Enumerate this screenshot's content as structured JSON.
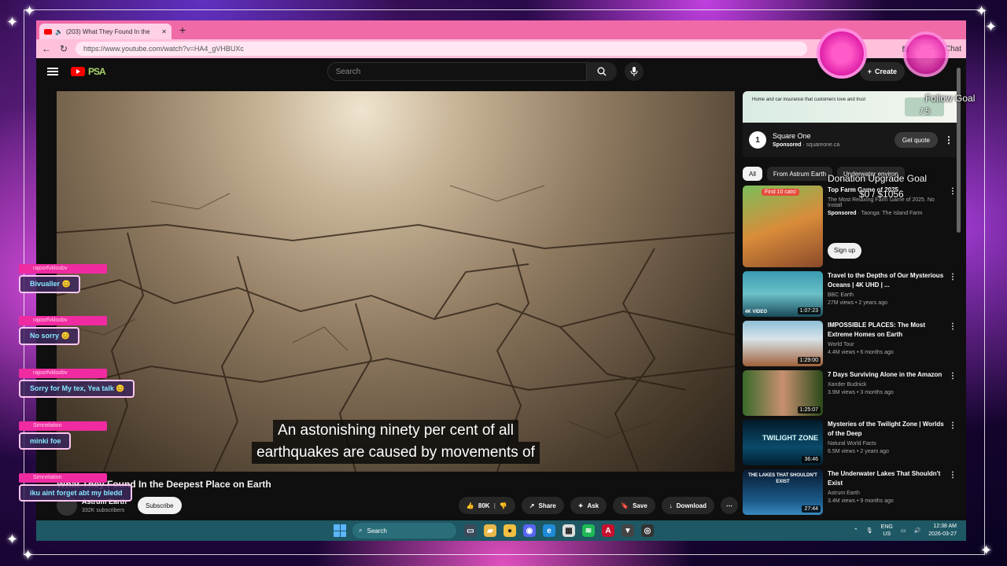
{
  "browser": {
    "tab_title": "(203) What They Found In the",
    "url": "https://www.youtube.com/watch?v=HA4_gVHBUXc",
    "chat_label": "Chat"
  },
  "youtube": {
    "search_placeholder": "Search",
    "create_label": "Create",
    "doodle": "PSA"
  },
  "video": {
    "title": "What They Found In the Deepest Place on Earth",
    "caption_line1": "An astonishing ninety per cent of all",
    "caption_line2": "earthquakes are caused by movements of",
    "channel_name": "Astrum Earth",
    "subscribers": "332K subscribers",
    "subscribe_label": "Subscribe",
    "likes": "80K",
    "share_label": "Share",
    "ask_label": "Ask",
    "save_label": "Save",
    "download_label": "Download"
  },
  "ad": {
    "banner_text": "Home and car insurance that customers love and trust",
    "advertiser": "Square One",
    "sponsored": "Sponsored",
    "domain": "squareone.ca",
    "cta": "Get quote"
  },
  "chips": [
    "All",
    "From Astrum Earth",
    "Underwater environ"
  ],
  "recommendations": [
    {
      "title": "Top Farm Game of 2025",
      "line2": "The Most Relaxing Farm Game of 2025. No Install",
      "sponsor": "Sponsored",
      "advertiser": "Taonga: The Island Farm",
      "badge": "Find 10 cats!",
      "cta": "Sign up"
    },
    {
      "title": "Travel to the Depths of Our Mysterious Oceans | 4K UHD | ...",
      "channel": "BBC Earth",
      "meta": "27M views • 2 years ago",
      "duration": "1:07:23",
      "thumb_label": "4K VIDEO"
    },
    {
      "title": "IMPOSSIBLE PLACES: The Most Extreme Homes on Earth",
      "channel": "World Tour",
      "meta": "4.4M views • 6 months ago",
      "duration": "1:29:00"
    },
    {
      "title": "7 Days Surviving Alone in the Amazon",
      "channel": "Xander Budnick",
      "meta": "3.9M views • 3 months ago",
      "duration": "1:25:07"
    },
    {
      "title": "Mysteries of the Twilight Zone | Worlds of the Deep",
      "channel": "Natural World Facts",
      "meta": "6.5M views • 2 years ago",
      "duration": "36:46",
      "thumb_label": "TWILIGHT ZONE"
    },
    {
      "title": "The Underwater Lakes That Shouldn't Exist",
      "channel": "Astrum Earth",
      "meta": "3.4M views • 9 months ago",
      "duration": "27:44",
      "thumb_label": "THE LAKES THAT SHOULDN'T EXIST"
    }
  ],
  "taskbar": {
    "search_label": "Search",
    "lang": "ENG",
    "region": "US",
    "time": "12:38 AM",
    "date": "2026-03-27"
  },
  "overlay": {
    "goal_title_1": "Follow Goal",
    "goal_value_1": "/ 5",
    "goal_title_2": "Donation Upgrade Goal",
    "goal_value_2": "$0 / $1056",
    "chat": [
      {
        "user": "rajoorfvkloobv",
        "msg": "Bivualler 😊"
      },
      {
        "user": "rajoorfvkloobv",
        "msg": "No sorry 😊"
      },
      {
        "user": "rajoorfvkloobv",
        "msg": "Sorry for My tex, Yea talk 😊"
      },
      {
        "user": "Simnelation",
        "msg": "minki foe"
      },
      {
        "user": "Simnelation",
        "msg": "iku aint forget abt my bledd"
      }
    ]
  },
  "colors": {
    "tab_bar": "#f06aa8",
    "yt_red": "#ff0000",
    "taskbar": "#1e5864",
    "chat_name_bg": "#f02aa0"
  }
}
